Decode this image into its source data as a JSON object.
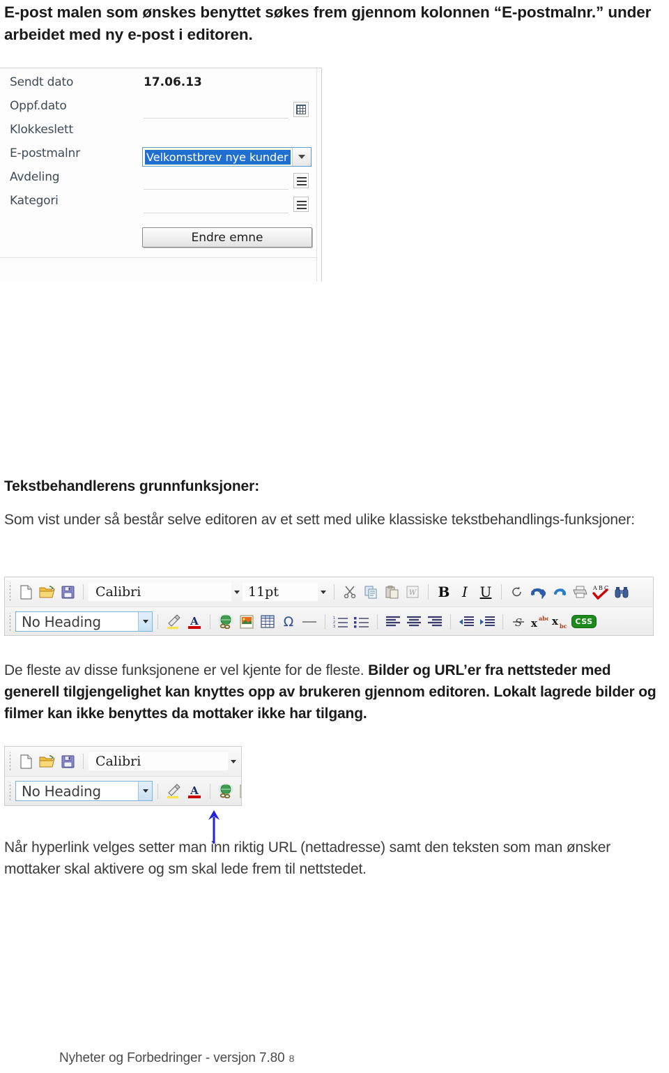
{
  "document": {
    "intro_paragraph": "E-post malen som ønskes benyttet søkes frem gjennom kolonnen “E-postmalnr.” under arbeidet med ny e-post i editoren.",
    "section_heading": "Tekstbehandlerens grunnfunksjoner:",
    "intro_paragraph_2": "Som vist under så består selve editoren av et sett med ulike klassiske tekstbehandlings-funksjoner:",
    "body_paragraph_1_plain": "De fleste av disse funksjonene er vel kjente for de fleste. ",
    "body_paragraph_1_bold": "Bilder og URL’er  fra nettsteder med generell tilgjengelighet kan knyttes opp av brukeren gjennom editoren. Lokalt lagrede bilder og filmer kan ikke benyttes da mottaker ikke har tilgang.",
    "body_paragraph_2": "Når hyperlink velges setter man inn riktig URL (nettadresse) samt den teksten som man ønsker mottaker skal aktivere og sm skal lede frem til nettstedet.",
    "footer_text": "Nyheter og Forbedringer -  versjon 7.80",
    "footer_page_number": "8"
  },
  "form_screenshot": {
    "rows": [
      {
        "label": "Sendt dato",
        "value": "17.06.13",
        "control": "static"
      },
      {
        "label": "Oppf.dato",
        "value": "",
        "control": "date"
      },
      {
        "label": "Klokkeslett",
        "value": "",
        "control": "none"
      },
      {
        "label": "E-postmalnr",
        "value": "Velkomstbrev nye kunder",
        "control": "combo"
      },
      {
        "label": "Avdeling",
        "value": "",
        "control": "lookup"
      },
      {
        "label": "Kategori",
        "value": "",
        "control": "lookup"
      }
    ],
    "button_label": "Endre emne",
    "selection_color": "#1f6fd0",
    "focus_border_color": "#5a9fd4",
    "field_highlight_color": "#fffbe0"
  },
  "editor_toolbar": {
    "font_name": "Calibri",
    "font_size": "11pt",
    "heading_style": "No Heading",
    "row1_icons": [
      "new-document-icon",
      "open-folder-icon",
      "save-disk-icon",
      "cut-scissors-icon",
      "copy-icon",
      "paste-icon",
      "paste-from-word-icon",
      "bold-icon",
      "italic-icon",
      "underline-icon",
      "refresh-icon",
      "undo-icon",
      "redo-icon",
      "print-icon",
      "spellcheck-icon",
      "find-binoculars-icon"
    ],
    "row1_labels": {
      "bold": "B",
      "italic": "I",
      "underline": "U"
    },
    "row2_icons": [
      "highlight-pen-icon",
      "font-color-icon",
      "hyperlink-globe-icon",
      "insert-image-icon",
      "insert-table-icon",
      "special-character-icon",
      "horizontal-rule-icon",
      "numbered-list-icon",
      "bulleted-list-icon",
      "align-left-icon",
      "align-center-icon",
      "align-right-icon",
      "outdent-icon",
      "indent-icon",
      "strikethrough-icon",
      "superscript-icon",
      "subscript-icon",
      "css-icon"
    ],
    "row2_labels": {
      "special_character": "Ω",
      "strikethrough": "S",
      "superscript_base": "x",
      "superscript_sup": "abc",
      "subscript_base": "x",
      "subscript_sub": "bc",
      "css": "CSS"
    },
    "accent_colors": {
      "heading_focus_border": "#7db3d8",
      "highlight_yellow": "#ffe14d",
      "font_color_red": "#cc0000",
      "css_green": "#1e8a1e",
      "undo_blue": "#2a5caa",
      "annotation_arrow": "#2222dd"
    }
  },
  "annotation": {
    "arrow_direction": "up",
    "arrow_color": "#2222dd",
    "points_to": "hyperlink-globe-icon"
  }
}
